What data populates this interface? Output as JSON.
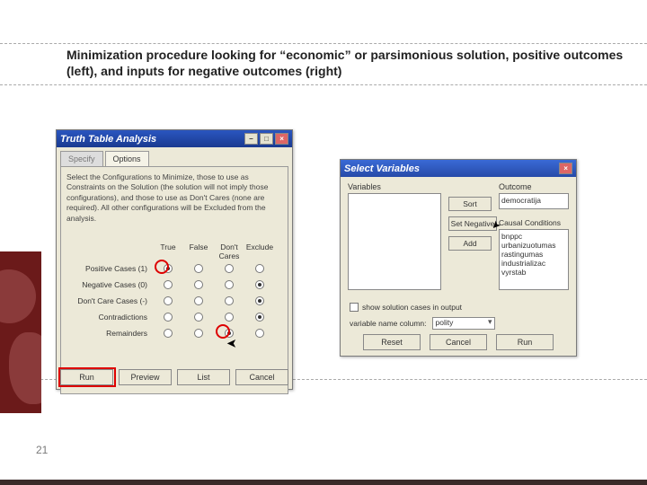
{
  "slide": {
    "title": "Minimization procedure looking for “economic” or parsimonious solution, positive outcomes (left), and inputs for negative outcomes (right)",
    "page_number": "21"
  },
  "leftWin": {
    "title": "Truth Table Analysis",
    "tabs": {
      "specify": "Specify",
      "options": "Options"
    },
    "instructions": "Select the Configurations to Minimize, those to use as Constraints on the Solution (the solution will not imply those configurations), and those to use as Don't Cares (none are required). All other configurations will be Excluded from the analysis.",
    "cols": {
      "true": "True",
      "false": "False",
      "dont": "Don't\nCares",
      "excl": "Exclude"
    },
    "rows": {
      "pos": "Positive Cases (1)",
      "neg": "Negative Cases (0)",
      "dc": "Don't Care Cases (-)",
      "con": "Contradictions",
      "rem": "Remainders"
    },
    "buttons": {
      "run": "Run",
      "preview": "Preview",
      "list": "List",
      "cancel": "Cancel"
    }
  },
  "rightWin": {
    "title": "Select Variables",
    "labels": {
      "variables": "Variables",
      "outcome": "Outcome",
      "causal": "Causal Conditions"
    },
    "buttons": {
      "sort": "Sort",
      "setneg": "Set Negative",
      "add": "Add",
      "reset": "Reset",
      "cancel": "Cancel",
      "run": "Run"
    },
    "outcome_item": "democratija",
    "causal_items": [
      "bnppc",
      "urbanizuotumas",
      "rastingumas",
      "industrializac",
      "vyrstab"
    ],
    "checkbox_label": "show solution cases in output",
    "varname_label": "variable name column:",
    "varname_value": "polity"
  }
}
